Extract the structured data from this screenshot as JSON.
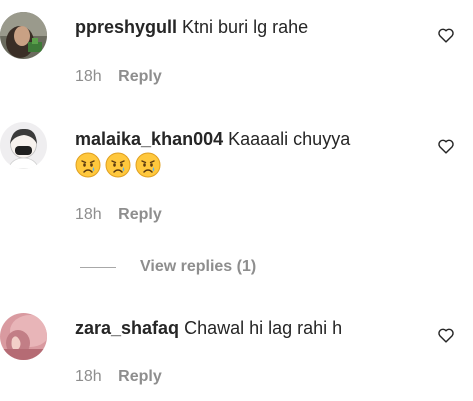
{
  "comments": [
    {
      "username": "ppreshygull",
      "text": "Ktni buri lg rahe",
      "time": "18h",
      "reply_label": "Reply",
      "avatar_icon": "profile-photo"
    },
    {
      "username": "malaika_khan004",
      "text": "Kaaaali chuyya",
      "emojis": [
        "😥",
        "😥",
        "😥"
      ],
      "time": "18h",
      "reply_label": "Reply",
      "view_replies_label": "View replies (1)",
      "avatar_icon": "profile-photo"
    },
    {
      "username": "zara_shafaq",
      "text": "Chawal hi lag rahi h",
      "time": "18h",
      "reply_label": "Reply",
      "avatar_icon": "profile-photo"
    }
  ],
  "colors": {
    "text": "#262626",
    "secondary": "#8e8e8e",
    "divider": "#a8a8a8"
  },
  "icons": {
    "like": "heart-outline-icon",
    "emoji": "sad-relieved-face"
  }
}
